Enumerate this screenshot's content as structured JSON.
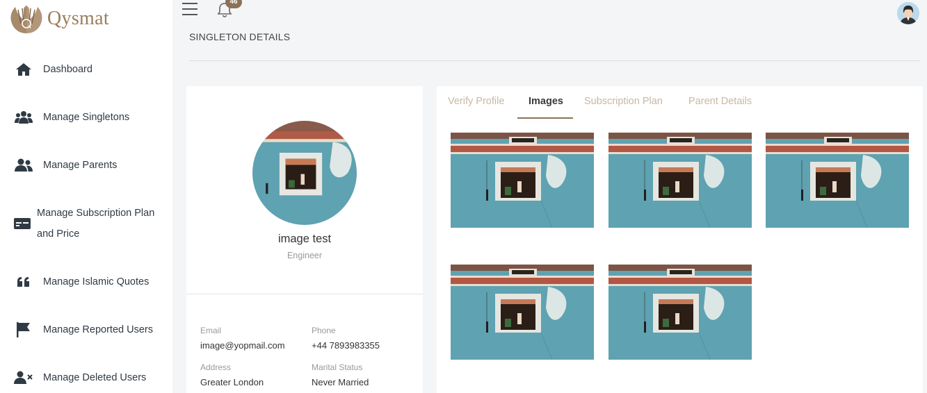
{
  "brand": {
    "name": "Qysmat",
    "color": "#9a7d5c",
    "icon": "praying-hands-logo"
  },
  "sidebar": {
    "items": [
      {
        "label": "Dashboard",
        "icon": "home-icon"
      },
      {
        "label": "Manage Singletons",
        "icon": "users-group-icon"
      },
      {
        "label": "Manage Parents",
        "icon": "user-friends-icon"
      },
      {
        "label_line1": "Manage Subscription Plan",
        "label_line2": "and Price",
        "icon": "card-icon"
      },
      {
        "label": "Manage Islamic Quotes",
        "icon": "quote-icon"
      },
      {
        "label": "Manage Reported Users",
        "icon": "flag-icon"
      },
      {
        "label": "Manage Deleted Users",
        "icon": "user-remove-icon"
      }
    ]
  },
  "topbar": {
    "notification_count": "46",
    "accent": "#8c7256"
  },
  "page": {
    "title": "SINGLETON DETAILS"
  },
  "profile": {
    "name": "image test",
    "job": "Engineer",
    "fields": {
      "email_label": "Email",
      "email": "image@yopmail.com",
      "phone_label": "Phone",
      "phone": "+44 7893983355",
      "address_label": "Address",
      "address": "Greater London",
      "marital_label": "Marital Status",
      "marital": "Never Married"
    }
  },
  "tabs": [
    {
      "label": "Verify Profile",
      "active": false
    },
    {
      "label": "Images",
      "active": true
    },
    {
      "label": "Subscription Plan",
      "active": false
    },
    {
      "label": "Parent Details",
      "active": false
    }
  ],
  "images": {
    "count": 5,
    "subject": "blue-wall-window-photo"
  }
}
